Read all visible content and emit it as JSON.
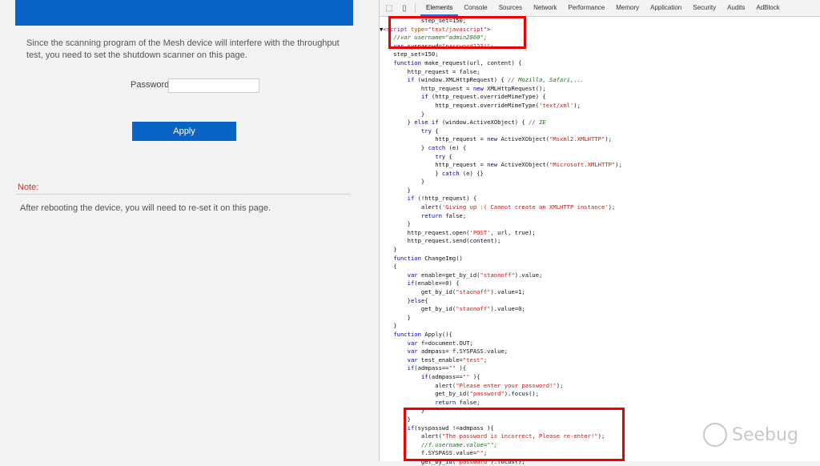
{
  "mesh": {
    "description": "Since the scanning program of the Mesh device will interfere with the throughput test, you need to set the shutdown scanner on this page.",
    "password_label": "Password:",
    "password_value": "",
    "apply_label": "Apply",
    "note_label": "Note:",
    "note_text": "After rebooting the device, you will need to re-set it on this page."
  },
  "devtools": {
    "tabs": [
      "Elements",
      "Console",
      "Sources",
      "Network",
      "Performance",
      "Memory",
      "Application",
      "Security",
      "Audits",
      "AdBlock"
    ],
    "active_tab": "Elements",
    "icons": [
      "inspect-icon",
      "device-toolbar-icon"
    ],
    "code_lines": [
      "            step_set=150;",
      "▼<script type=\"text/javascript\">",
      "    //var username=\"admin2860\";",
      "    var syspasswd=\"password123!\";",
      "    step_set=150;",
      "    function make_request(url, content) {",
      "        http_request = false;",
      "        if (window.XMLHttpRequest) { // Mozilla, Safari,...",
      "            http_request = new XMLHttpRequest();",
      "            if (http_request.overrideMimeType) {",
      "                http_request.overrideMimeType('text/xml');",
      "            }",
      "        } else if (window.ActiveXObject) { // IE",
      "            try {",
      "                http_request = new ActiveXObject(\"Msxml2.XMLHTTP\");",
      "            } catch (e) {",
      "                try {",
      "                http_request = new ActiveXObject(\"Microsoft.XMLHTTP\");",
      "                } catch (e) {}",
      "            }",
      "        }",
      "        if (!http_request) {",
      "            alert('Giving up :( Cannot create an XMLHTTP instance');",
      "            return false;",
      "        }",
      "        http_request.open('POST', url, true);",
      "        http_request.send(content);",
      "    }",
      "    function ChangeImg()",
      "    {",
      "        var enable=get_by_id(\"staonoff\").value;",
      "        if(enable==0) {",
      "            get_by_id(\"staonoff\").value=1;",
      "        }else{",
      "            get_by_id(\"staonoff\").value=0;",
      "        }",
      "    }",
      "    function Apply(){",
      "        var f=document.OUT;",
      "        var admpass= f.SYSPASS.value;",
      "        var test_enable=\"test\";",
      "        if(admpass==\"\" ){",
      "            if(admpass==\"\" ){",
      "                alert(\"Please enter your password!\");",
      "                get_by_id(\"password\").focus();",
      "                return false;",
      "            }",
      "        }",
      "        if(syspasswd !=admpass ){",
      "            alert(\"The password is incorrect, Please re-enter!\");",
      "            //f.username.value=\"\";",
      "            f.SYSPASS.value=\"\";",
      "            get_by_id(\"password\").focus();"
    ]
  },
  "watermark": {
    "text": "Seebug"
  },
  "colors": {
    "accent": "#0a64c8",
    "highlight": "#e00000",
    "note": "#d0342c"
  }
}
